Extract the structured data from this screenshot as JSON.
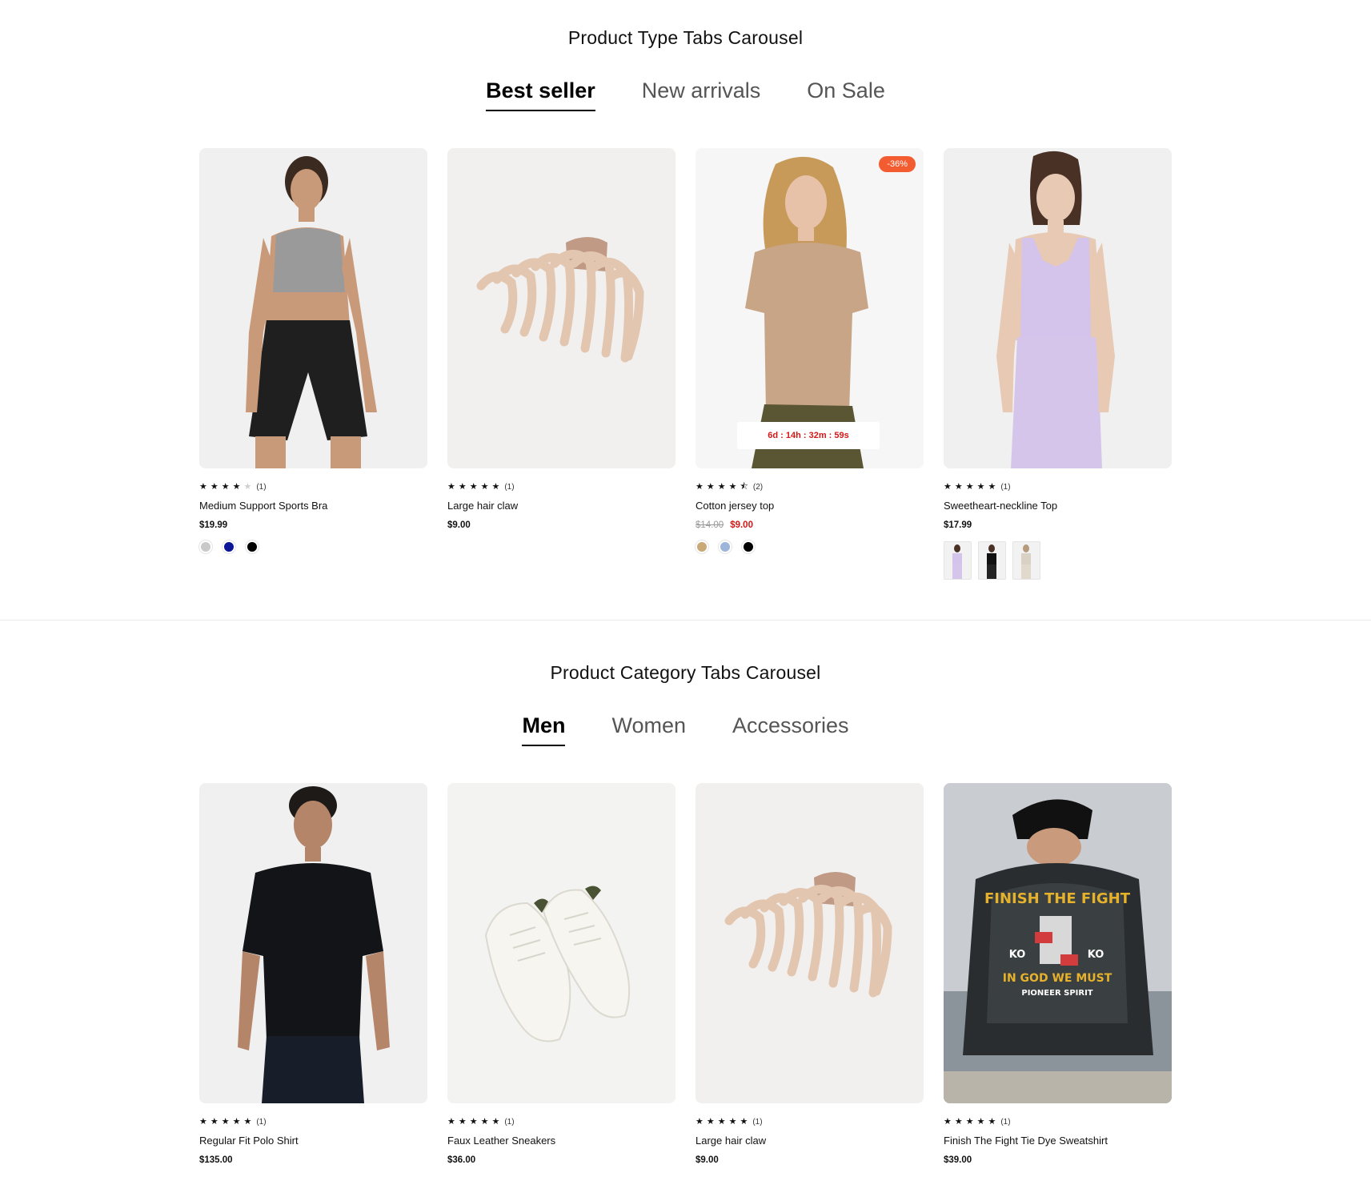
{
  "type_section": {
    "title": "Product Type Tabs Carousel",
    "tabs": [
      {
        "label": "Best seller",
        "active": true
      },
      {
        "label": "New arrivals",
        "active": false
      },
      {
        "label": "On Sale",
        "active": false
      }
    ],
    "products": [
      {
        "name": "Medium Support Sports Bra",
        "rating": 4,
        "reviews": "(1)",
        "price": "$19.99",
        "swatches": [
          "#c9c9c9",
          "#0b1596",
          "#000000"
        ]
      },
      {
        "name": "Large hair claw",
        "rating": 5,
        "reviews": "(1)",
        "price": "$9.00"
      },
      {
        "name": "Cotton jersey top",
        "rating": 4.5,
        "reviews": "(2)",
        "old_price": "$14.00",
        "price": "$9.00",
        "badge": "-36%",
        "countdown": "6d : 14h : 32m : 59s",
        "swatches": [
          "#c9a978",
          "#9db5d8",
          "#000000"
        ]
      },
      {
        "name": "Sweetheart-neckline Top",
        "rating": 5,
        "reviews": "(1)",
        "price": "$17.99",
        "thumbs": [
          "lavender",
          "black",
          "beige"
        ]
      }
    ]
  },
  "category_section": {
    "title": "Product Category Tabs Carousel",
    "tabs": [
      {
        "label": "Men",
        "active": true
      },
      {
        "label": "Women",
        "active": false
      },
      {
        "label": "Accessories",
        "active": false
      }
    ],
    "products": [
      {
        "name": "Regular Fit Polo Shirt",
        "rating": 5,
        "reviews": "(1)",
        "price": "$135.00"
      },
      {
        "name": "Faux Leather Sneakers",
        "rating": 5,
        "reviews": "(1)",
        "price": "$36.00"
      },
      {
        "name": "Large hair claw",
        "rating": 5,
        "reviews": "(1)",
        "price": "$9.00"
      },
      {
        "name": "Finish The Fight Tie Dye Sweatshirt",
        "rating": 5,
        "reviews": "(1)",
        "price": "$39.00",
        "print_text": {
          "top": "FINISH THE FIGHT",
          "left": "KO",
          "right": "KO",
          "middle": "IN GOD WE MUST",
          "bottom": "PIONEER SPIRIT"
        }
      }
    ]
  },
  "colors": {
    "sale": "#d31717",
    "badge": "#f25c30",
    "tab_active": "#000000",
    "tab_inactive": "#555555"
  },
  "icons": {
    "star": "star-icon",
    "star_empty": "star-empty-icon"
  }
}
